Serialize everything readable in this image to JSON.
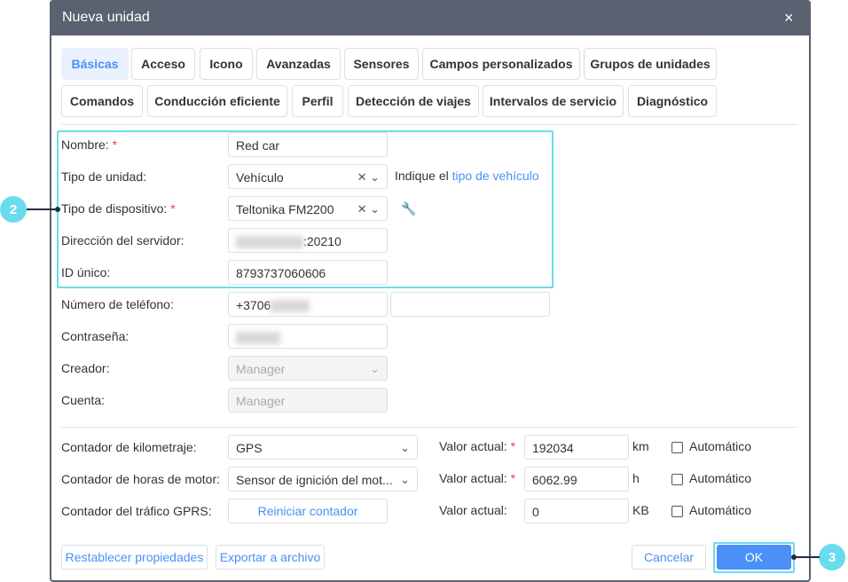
{
  "dialog": {
    "title": "Nueva unidad",
    "close_icon": "×"
  },
  "tabs_row1": [
    "Básicas",
    "Acceso",
    "Icono",
    "Avanzadas",
    "Sensores",
    "Campos personalizados",
    "Grupos de unidades"
  ],
  "tabs_row2": [
    "Comandos",
    "Conducción eficiente",
    "Perfil",
    "Detección de viajes",
    "Intervalos de servicio",
    "Diagnóstico"
  ],
  "form": {
    "name": {
      "label": "Nombre:",
      "value": "Red car"
    },
    "unit_type": {
      "label": "Tipo de unidad:",
      "value": "Vehículo",
      "hint": "Indique el",
      "hint_link": "tipo de vehículo"
    },
    "device_type": {
      "label": "Tipo de dispositivo:",
      "value": "Teltonika FM2200"
    },
    "server": {
      "label": "Dirección del servidor:",
      "value_suffix": ":20210"
    },
    "uid": {
      "label": "ID único:",
      "value": "8793737060606"
    },
    "phone": {
      "label": "Número de teléfono:",
      "value_prefix": "+3706"
    },
    "password": {
      "label": "Contraseña:"
    },
    "creator": {
      "label": "Creador:",
      "value": "Manager"
    },
    "account": {
      "label": "Cuenta:",
      "value": "Manager"
    },
    "required_mark": "*"
  },
  "counters": [
    {
      "label": "Contador de kilometraje:",
      "select": "GPS",
      "value_label": "Valor actual:",
      "required": true,
      "value": "192034",
      "unit": "km",
      "auto": "Automático"
    },
    {
      "label": "Contador de horas de motor:",
      "select": "Sensor de ignición del mot...",
      "value_label": "Valor actual:",
      "required": true,
      "value": "6062.99",
      "unit": "h",
      "auto": "Automático"
    },
    {
      "label": "Contador del tráfico GPRS:",
      "button": "Reiniciar contador",
      "value_label": "Valor actual:",
      "required": false,
      "value": "0",
      "unit": "KB",
      "auto": "Automático"
    }
  ],
  "footer": {
    "reset": "Restablecer propiedades",
    "export": "Exportar a archivo",
    "cancel": "Cancelar",
    "ok": "OK"
  },
  "callouts": [
    "2",
    "3"
  ],
  "colors": {
    "header": "#5a6170",
    "accent": "#4a90f7",
    "highlight": "#6adbee"
  }
}
